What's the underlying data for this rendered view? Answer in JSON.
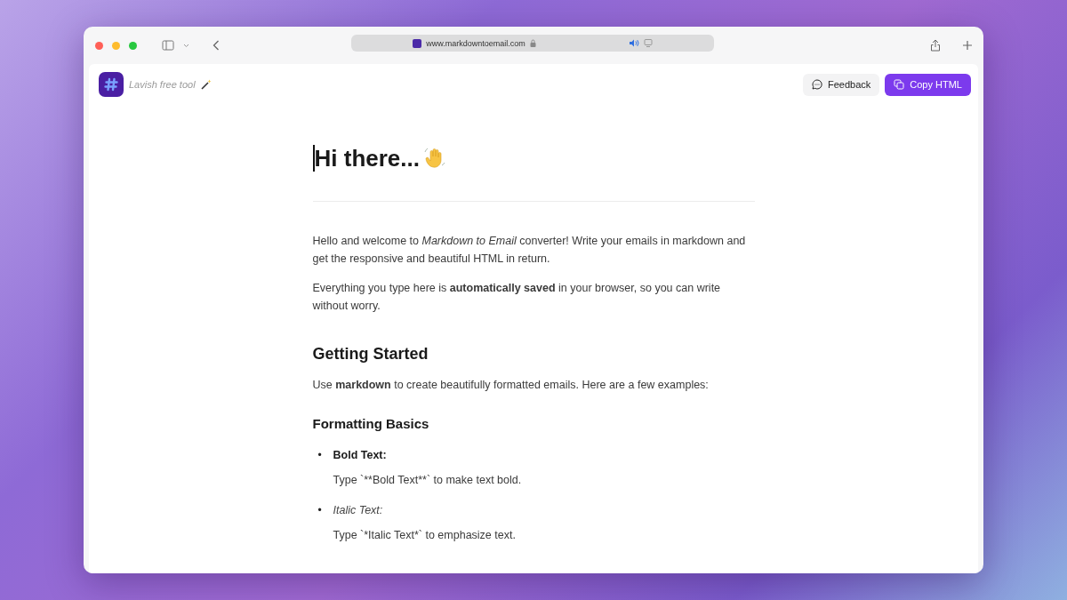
{
  "browser": {
    "url": "www.markdowntoemail.com"
  },
  "header": {
    "tagline": "Lavish free tool",
    "buttons": [
      {
        "label": "Feedback",
        "kind": "secondary"
      },
      {
        "label": "Copy HTML",
        "kind": "primary"
      }
    ]
  },
  "document": {
    "title": "Hi there...",
    "blocks": [
      {
        "kind": "paragraph",
        "text": "Hello and welcome to *Markdown to Email* converter! Write your emails in markdown and get the responsive and beautiful HTML in return."
      },
      {
        "kind": "paragraph",
        "text": "Everything you type here is **automatically saved** in your browser, so you can write without worry."
      },
      {
        "kind": "heading",
        "text": "Getting Started"
      },
      {
        "kind": "paragraph",
        "text": "Use **markdown** to create beautifully formatted emails. Here are a few examples:"
      },
      {
        "kind": "subheading",
        "text": "Formatting Basics"
      },
      {
        "kind": "list",
        "items": [
          {
            "marker": "•",
            "label": "Bold Text:",
            "kind": "bold",
            "description": "Type `**Bold Text**` to make text bold."
          },
          {
            "marker": "•",
            "label": "Italic Text:",
            "kind": "italic",
            "description": "Type `*Italic Text*` to emphasize text."
          }
        ]
      }
    ]
  }
}
